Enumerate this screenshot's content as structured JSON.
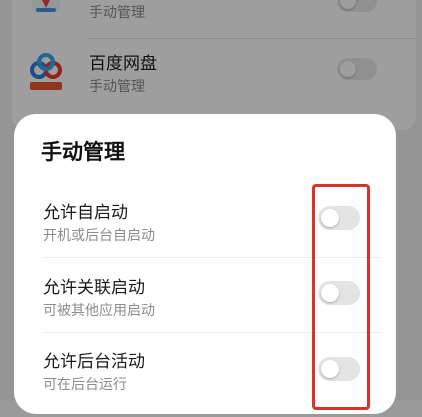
{
  "background_list": {
    "apps": [
      {
        "name": "",
        "subtitle": "手动管理",
        "icon": "maps-pin-icon"
      },
      {
        "name": "百度网盘",
        "subtitle": "手动管理",
        "icon": "baidu-netdisk-icon"
      }
    ]
  },
  "dialog": {
    "title": "手动管理",
    "options": [
      {
        "title": "允许自启动",
        "subtitle": "开机或后台自启动",
        "enabled": false
      },
      {
        "title": "允许关联启动",
        "subtitle": "可被其他应用启动",
        "enabled": false
      },
      {
        "title": "允许后台活动",
        "subtitle": "可在后台运行",
        "enabled": false
      }
    ]
  },
  "colors": {
    "highlight": "#e0302a",
    "toggle_off": "#e4e4e4",
    "baidu_blue": "#2f7de1",
    "baidu_red": "#e63a2e"
  }
}
